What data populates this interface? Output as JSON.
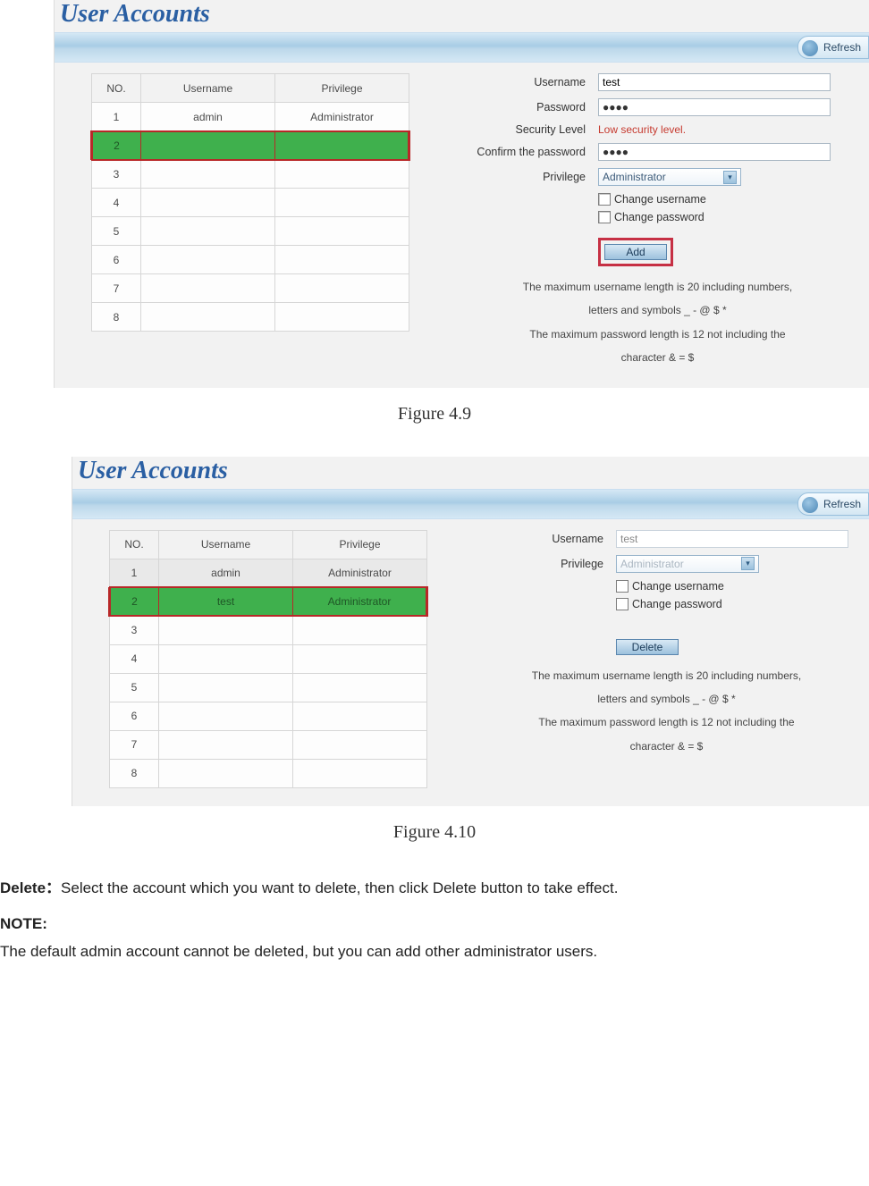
{
  "fig1": {
    "title": "User Accounts",
    "refresh": "Refresh",
    "table": {
      "headers": {
        "no": "NO.",
        "user": "Username",
        "priv": "Privilege"
      },
      "rows": [
        {
          "no": "1",
          "user": "admin",
          "priv": "Administrator"
        },
        {
          "no": "2",
          "user": "",
          "priv": "",
          "selected": true
        },
        {
          "no": "3",
          "user": "",
          "priv": ""
        },
        {
          "no": "4",
          "user": "",
          "priv": ""
        },
        {
          "no": "5",
          "user": "",
          "priv": ""
        },
        {
          "no": "6",
          "user": "",
          "priv": ""
        },
        {
          "no": "7",
          "user": "",
          "priv": ""
        },
        {
          "no": "8",
          "user": "",
          "priv": ""
        }
      ]
    },
    "form": {
      "username_label": "Username",
      "username_value": "test",
      "password_label": "Password",
      "password_value": "●●●●",
      "security_label": "Security Level",
      "security_value": "Low security level.",
      "confirm_label": "Confirm the password",
      "confirm_value": "●●●●",
      "privilege_label": "Privilege",
      "privilege_value": "Administrator",
      "change_user": "Change username",
      "change_pass": "Change password",
      "button": "Add"
    },
    "hints": {
      "line1": "The maximum username length is 20 including numbers,",
      "line2": "letters and symbols _ - @ $ *",
      "line3": "The maximum password length is 12 not including the",
      "line4": "character & = $"
    },
    "caption": "Figure 4.9"
  },
  "fig2": {
    "title": "User Accounts",
    "refresh": "Refresh",
    "table": {
      "headers": {
        "no": "NO.",
        "user": "Username",
        "priv": "Privilege"
      },
      "rows": [
        {
          "no": "1",
          "user": "admin",
          "priv": "Administrator",
          "alt": true
        },
        {
          "no": "2",
          "user": "test",
          "priv": "Administrator",
          "selected": true
        },
        {
          "no": "3",
          "user": "",
          "priv": ""
        },
        {
          "no": "4",
          "user": "",
          "priv": ""
        },
        {
          "no": "5",
          "user": "",
          "priv": ""
        },
        {
          "no": "6",
          "user": "",
          "priv": ""
        },
        {
          "no": "7",
          "user": "",
          "priv": ""
        },
        {
          "no": "8",
          "user": "",
          "priv": ""
        }
      ]
    },
    "form": {
      "username_label": "Username",
      "username_value": "test",
      "privilege_label": "Privilege",
      "privilege_value": "Administrator",
      "change_user": "Change username",
      "change_pass": "Change password",
      "button": "Delete"
    },
    "hints": {
      "line1": "The maximum username length is 20 including numbers,",
      "line2": "letters and symbols _ - @ $ *",
      "line3": "The maximum password length is 12 not including the",
      "line4": "character & = $"
    },
    "caption": "Figure 4.10"
  },
  "doc": {
    "delete_label": "Delete：",
    "delete_text": "Select the account which you want to delete, then click Delete button to take effect.",
    "note_label": "NOTE:",
    "note_text": "The default admin account cannot be deleted, but you can add other administrator users."
  }
}
